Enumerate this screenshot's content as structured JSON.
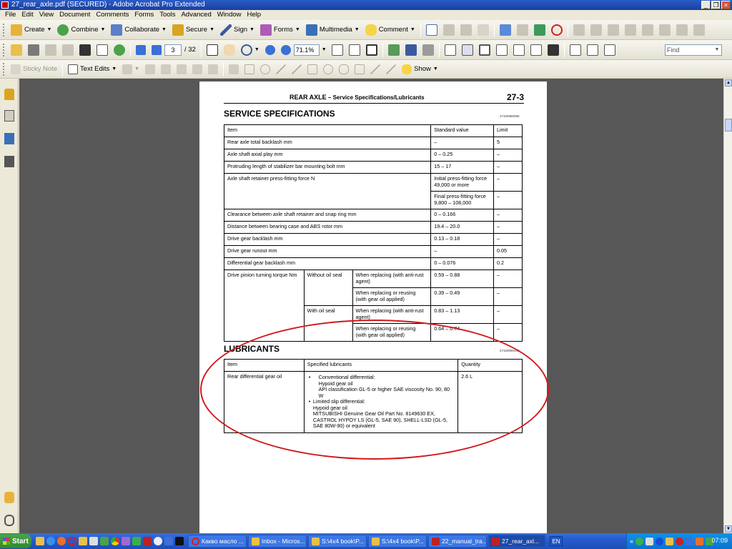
{
  "window": {
    "title": "27_rear_axle.pdf (SECURED) - Adobe Acrobat Pro Extended"
  },
  "menu": [
    "File",
    "Edit",
    "View",
    "Document",
    "Comments",
    "Forms",
    "Tools",
    "Advanced",
    "Window",
    "Help"
  ],
  "toolbar1": {
    "create": "Create",
    "combine": "Combine",
    "collaborate": "Collaborate",
    "secure": "Secure",
    "sign": "Sign",
    "forms": "Forms",
    "multimedia": "Multimedia",
    "comment": "Comment"
  },
  "toolbar2": {
    "page_current": "3",
    "page_total": "/ 32",
    "zoom": "71.1%",
    "find_placeholder": "Find"
  },
  "toolbar3": {
    "sticky_note": "Sticky Note",
    "text_edits": "Text Edits",
    "show": "Show"
  },
  "page": {
    "section": "REAR AXLE",
    "subtitle": " – Service Specifications/Lubricants",
    "page_number": "27-3",
    "service_specs": {
      "title": "SERVICE SPECIFICATIONS",
      "code": "27100080058",
      "headers": [
        "Item",
        "Standard value",
        "Limit"
      ],
      "rows": [
        {
          "item": "Rear axle total backlash mm",
          "std": "–",
          "limit": "5"
        },
        {
          "item": "Axle shaft axial play mm",
          "std": "0 – 0.25",
          "limit": "–"
        },
        {
          "item": "Protruding length of stabilizer bar mounting bolt mm",
          "std": "15 – 17",
          "limit": "–"
        },
        {
          "item": "Axle shaft retainer press-fitting force N",
          "std": "Initial press-fitting force 49,000 or more",
          "limit": "–"
        },
        {
          "std": "Final press-fitting force 9,800 – 108,000",
          "limit": "–"
        },
        {
          "item": "Clearance between axle shaft retainer and snap ring mm",
          "std": "0 – 0.166",
          "limit": "–"
        },
        {
          "item": "Distance between bearing case and ABS rotor mm",
          "std": "19.4 – 20.0",
          "limit": "–"
        },
        {
          "item": "Drive gear backlash mm",
          "std": "0.13 – 0.18",
          "limit": "–"
        },
        {
          "item": "Drive gear runout mm",
          "std": "–",
          "limit": "0.05"
        },
        {
          "item": "Differential gear backlash mm",
          "std": "0 – 0.076",
          "limit": "0.2"
        }
      ],
      "torque": {
        "item": "Drive pinion turning torque Nm",
        "without_seal": "Without oil seal",
        "with_seal": "With oil seal",
        "replacing_rust": "When replacing (with anti-rust agent)",
        "replacing_oil": "When replacing or reusing (with gear oil applied)",
        "v1": "0.59 – 0.88",
        "v2": "0.39 – 0.49",
        "v3": "0.83 – 1.13",
        "v4": "0.64 – 0.74",
        "dash": "–"
      }
    },
    "lubricants": {
      "title": "LUBRICANTS",
      "code": "27100090148",
      "headers": [
        "Item",
        "Specified lubricants",
        "Quantity"
      ],
      "item": "Rear differential gear oil",
      "bullet1_title": "Conventional differential:",
      "bullet1_l1": "Hypoid gear oil",
      "bullet1_l2": "API classification GL-5 or higher SAE viscosity No. 90, 80 W",
      "bullet2_title": "Limited slip differential:",
      "bullet2_l1": "Hypoid gear oil",
      "bullet2_l2": "MITSUBISHI Genuine Gear Oil Part No. 8149630 EX, CASTROL HYPOY LS (GL-5, SAE 90), SHELL-LSD (GL-5, SAE 80W-90) or equivalent",
      "quantity": "2.6 L"
    }
  },
  "taskbar": {
    "start": "Start",
    "tasks": [
      "Какво масло ...",
      "Inbox - Micros...",
      "S:\\4x4 book\\P...",
      "S:\\4x4 book\\P...",
      "22_manual_tra...",
      "27_rear_axl..."
    ],
    "lang": "EN",
    "clock": "07:09"
  },
  "colors": {
    "annotation": "#d01a1a",
    "title_bar": "#1a3fa0",
    "doc_bg": "#575757"
  }
}
